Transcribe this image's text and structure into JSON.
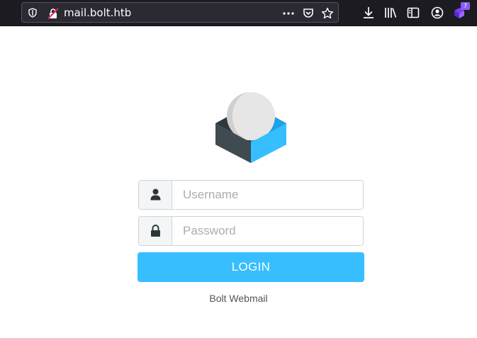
{
  "browser": {
    "url": "mail.bolt.htb",
    "extension_badge": "7"
  },
  "login": {
    "username_placeholder": "Username",
    "password_placeholder": "Password",
    "login_label": "LOGIN",
    "product_name": "Bolt Webmail"
  },
  "colors": {
    "accent": "#37beff",
    "toolbar": "#1c1b22"
  }
}
